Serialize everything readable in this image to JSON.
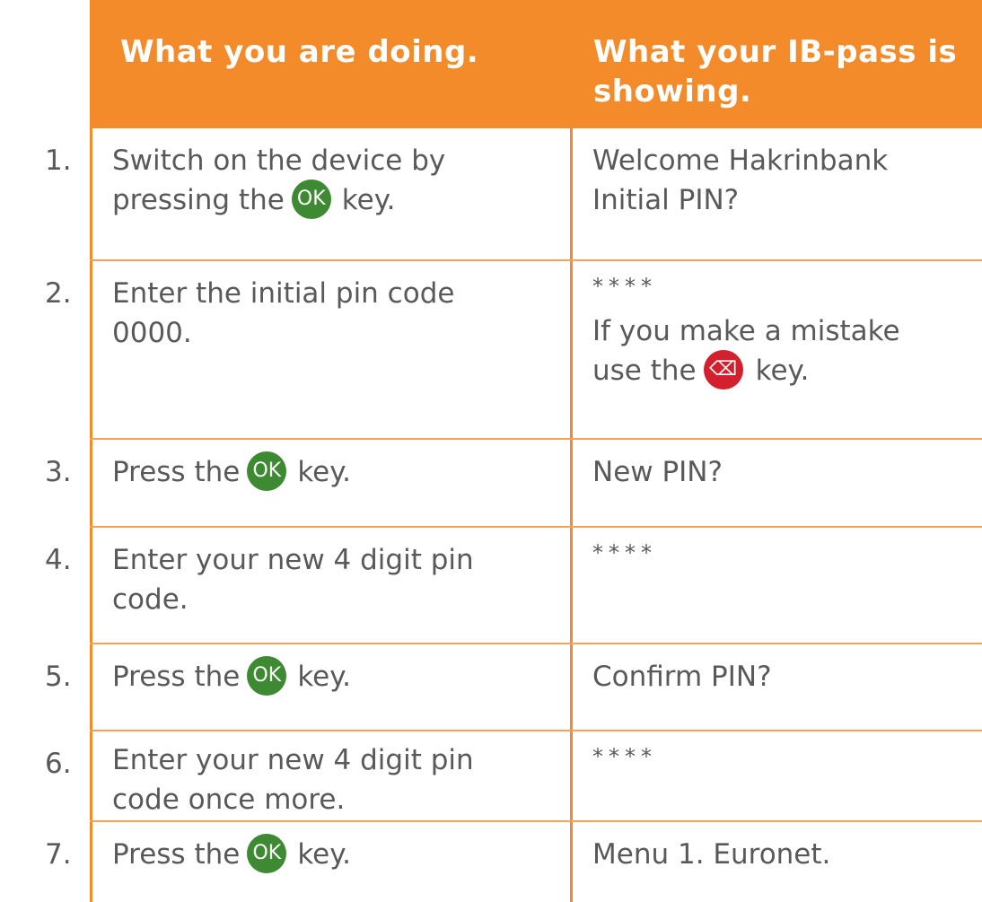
{
  "colors": {
    "accent": "#f38b2a",
    "ok_key": "#3e8a32",
    "delete_key": "#d2202f",
    "text": "#595959"
  },
  "header": {
    "col_action": "What you are doing.",
    "col_display_line1": "What your IB-pass is",
    "col_display_line2": "showing."
  },
  "keys": {
    "ok_label": "OK",
    "delete_icon": "backspace-icon",
    "delete_glyph": "⌫"
  },
  "rows": [
    {
      "num": "1.",
      "action_before": "Switch on the device by",
      "action_line2_before": "pressing the",
      "action_after": "key.",
      "display_line1": "Welcome Hakrinbank",
      "display_line2": "Initial PIN?"
    },
    {
      "num": "2.",
      "action_line1": "Enter the initial pin code",
      "action_line2": "0000.",
      "display_stars": "****",
      "display_line1": "If you make a mistake",
      "display_line2_before": "use the",
      "display_line2_after": "key."
    },
    {
      "num": "3.",
      "action_before": "Press the",
      "action_after": "key.",
      "display": "New PIN?"
    },
    {
      "num": "4.",
      "action_line1": "Enter your new 4 digit pin",
      "action_line2": "code.",
      "display_stars": "****"
    },
    {
      "num": "5.",
      "action_before": "Press the",
      "action_after": "key.",
      "display": "Confirm PIN?"
    },
    {
      "num": "6.",
      "action_line1": "Enter your new 4 digit pin",
      "action_line2": "code once more.",
      "display_stars": "****"
    },
    {
      "num": "7.",
      "action_before": "Press the",
      "action_after": "key.",
      "display": "Menu 1. Euronet."
    }
  ]
}
